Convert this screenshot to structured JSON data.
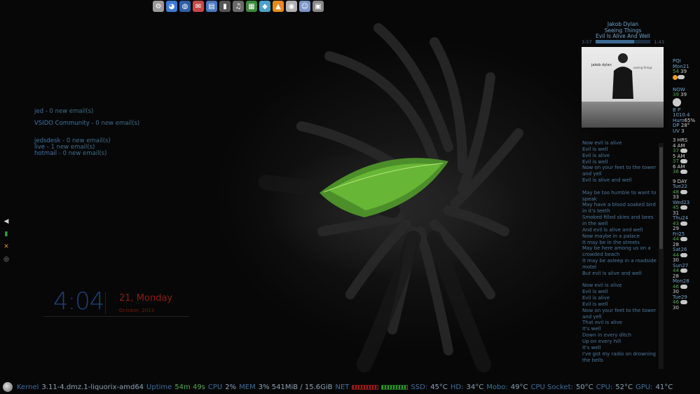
{
  "dock": {
    "items": [
      {
        "name": "system-icon",
        "color": "#9a9a9a",
        "glyph": "⚙"
      },
      {
        "name": "browser-icon",
        "color": "#3a7bd5",
        "glyph": "◕"
      },
      {
        "name": "network-icon",
        "color": "#2f5fa8",
        "glyph": "◍"
      },
      {
        "name": "mail-icon",
        "color": "#c84848",
        "glyph": "✉"
      },
      {
        "name": "document-icon",
        "color": "#4a78c0",
        "glyph": "▤"
      },
      {
        "name": "terminal-icon",
        "color": "#555555",
        "glyph": "▮"
      },
      {
        "name": "media-player-icon",
        "color": "#6a6a6a",
        "glyph": "♫"
      },
      {
        "name": "archive-icon",
        "color": "#3a8a3a",
        "glyph": "▦"
      },
      {
        "name": "cube-icon",
        "color": "#4ca0c8",
        "glyph": "◆"
      },
      {
        "name": "vlc-icon",
        "color": "#e68a1e",
        "glyph": "▲"
      },
      {
        "name": "disc-icon",
        "color": "#b0b0b0",
        "glyph": "◉"
      },
      {
        "name": "user-icon",
        "color": "#7a96c8",
        "glyph": "☺"
      },
      {
        "name": "lock-icon",
        "color": "#888888",
        "glyph": "▣"
      }
    ]
  },
  "email": {
    "accounts": [
      {
        "name": "jed",
        "count": "-  0 new email(s)"
      },
      {
        "name": "VSIDO Community",
        "count": "-  0 new email(s)"
      },
      {
        "name": "jedsdesk",
        "count": "-  0 new email(s)"
      },
      {
        "name": "live",
        "count": "-  1 new email(s)"
      },
      {
        "name": "hotmail",
        "count": "-  0 new email(s)"
      }
    ]
  },
  "clock": {
    "time": "4:04",
    "day": "21, Monday",
    "month_year": "October, 2013"
  },
  "side_icons": [
    {
      "name": "volume-icon",
      "color": "#d0d0d0",
      "glyph": "◀"
    },
    {
      "name": "battery-icon",
      "color": "#3aa03a",
      "glyph": "▮"
    },
    {
      "name": "tools-icon",
      "color": "#e08a2a",
      "glyph": "✕"
    },
    {
      "name": "settings-icon",
      "color": "#a0a0a0",
      "glyph": "◎"
    }
  ],
  "music": {
    "artist": "Jakob Dylan",
    "album": "Seeing Things",
    "track": "Evil Is Alive And Well",
    "elapsed": "3:57",
    "remaining": "1:43",
    "progress": 0.7,
    "cover_artist": "jakob dylan",
    "cover_title": "seeing things"
  },
  "lyrics": [
    "Now evil is alive",
    "Evil is well",
    "Evil is alive",
    "Evil is well",
    "Now on your feet to the tower and yell",
    "Evil is alive and well",
    "",
    "May be too humble to want to speak",
    "May have a blood soaked bird in it's teeth",
    "Smoked filled skies and bees in the well",
    "And evil is alive and well",
    "Now maybe in a palace",
    "It may be in the streets",
    "May be here among us on a crowded beach",
    "It may be asleep in a roadside motel",
    "But evil is alive and well",
    "",
    "Now evil is alive",
    "Evil is well",
    "Evil is alive",
    "Evil is well",
    "Now on your feet to the tower and yell",
    "That evil is alive",
    "It's well",
    "Down in every ditch",
    "Up on every hill",
    "It's well",
    "I've got my radio on drowning the bells"
  ],
  "weather": {
    "location": "PQI",
    "date": "Mon21",
    "hi": "54",
    "lo": "39",
    "now_label": "NOW",
    "now_a": "39",
    "now_b": "39",
    "bp_label": "B P",
    "bp": "1010.4",
    "hum_label": "Hum",
    "hum": "65%",
    "dp_label": "DP",
    "dp": "28°",
    "uv_label": "UV",
    "uv": "3",
    "hrs_title": "3  HRS",
    "hours": [
      {
        "label": "4  AM",
        "temp": "37"
      },
      {
        "label": "5  AM",
        "temp": "37"
      },
      {
        "label": "6  AM",
        "temp": "36"
      }
    ],
    "day_title": "9  DAY",
    "days": [
      {
        "day": "Tue22",
        "hi": "48",
        "lo": "33"
      },
      {
        "day": "Wed23",
        "hi": "45",
        "lo": "31"
      },
      {
        "day": "Thu24",
        "hi": "43",
        "lo": "29"
      },
      {
        "day": "Fri25",
        "hi": "44",
        "lo": "28"
      },
      {
        "day": "Sat26",
        "hi": "44",
        "lo": "30"
      },
      {
        "day": "Sun27",
        "hi": "44",
        "lo": "28"
      },
      {
        "day": "Mon28",
        "hi": "46",
        "lo": "30"
      },
      {
        "day": "Tue29",
        "hi": "46",
        "lo": "30"
      }
    ]
  },
  "status": {
    "kernel_label": "Kernel",
    "kernel": "3.11-4.dmz.1-liquorix-amd64",
    "uptime_label": "Uptime",
    "uptime": "54m 49s",
    "cpu_label": "CPU",
    "cpu": "2%",
    "mem_label": "MEM",
    "mem": "3% 541MiB / 15.6GiB",
    "net_label": "NET",
    "ssd_label": "SSD:",
    "ssd": "45°C",
    "hd_label": "HD:",
    "hd": "34°C",
    "mobo_label": "Mobo:",
    "mobo": "49°C",
    "socket_label": "CPU Socket:",
    "socket": "50°C",
    "cpu2_label": "CPU:",
    "cpu2": "52°C",
    "gpu_label": "GPU:",
    "gpu": "41°C"
  }
}
